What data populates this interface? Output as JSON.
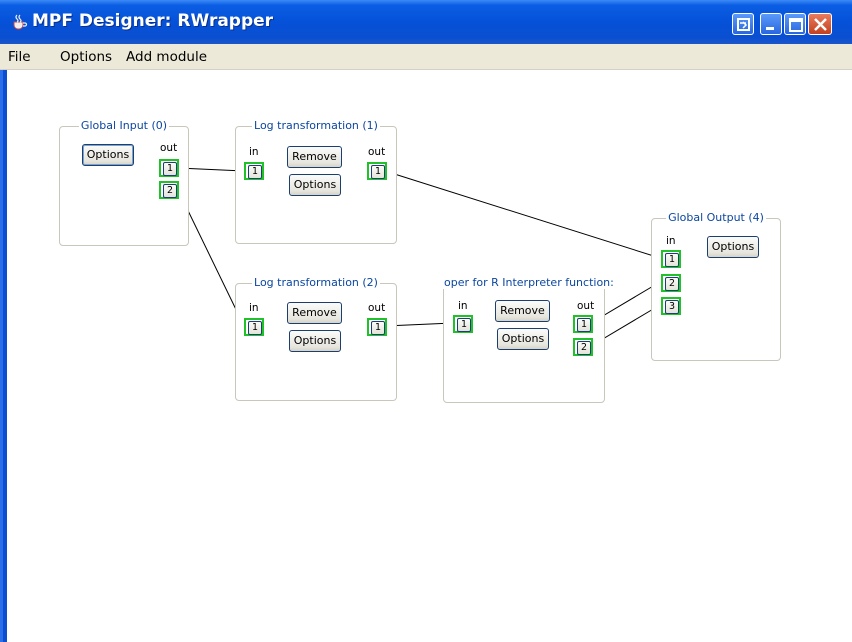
{
  "window": {
    "title": "MPF Designer: RWrapper"
  },
  "menu": [
    "File",
    "Options",
    "Add module"
  ],
  "modules": {
    "global_input": {
      "title": "Global Input (0)",
      "out_label": "out",
      "options": "Options",
      "outs": [
        "1",
        "2"
      ]
    },
    "log1": {
      "title": "Log transformation (1)",
      "in_label": "in",
      "out_label": "out",
      "remove": "Remove",
      "options": "Options",
      "ins": [
        "1"
      ],
      "outs": [
        "1"
      ]
    },
    "log2": {
      "title": "Log transformation (2)",
      "in_label": "in",
      "out_label": "out",
      "remove": "Remove",
      "options": "Options",
      "ins": [
        "1"
      ],
      "outs": [
        "1"
      ]
    },
    "rwrapper": {
      "title": "oper for R Interpreter function:",
      "in_label": "in",
      "out_label": "out",
      "remove": "Remove",
      "options": "Options",
      "ins": [
        "1"
      ],
      "outs": [
        "1",
        "2"
      ]
    },
    "global_output": {
      "title": "Global Output (4)",
      "in_label": "in",
      "options": "Options",
      "ins": [
        "1",
        "2",
        "3"
      ]
    }
  },
  "icons": {
    "app": "java-cup-icon",
    "extra": "restore-window-icon",
    "min": "minimize-icon",
    "max": "maximize-icon",
    "close": "close-icon"
  },
  "colors": {
    "title_bar": "#0a4fd1",
    "port_border": "#21c12a",
    "module_title": "#0c47a0"
  }
}
